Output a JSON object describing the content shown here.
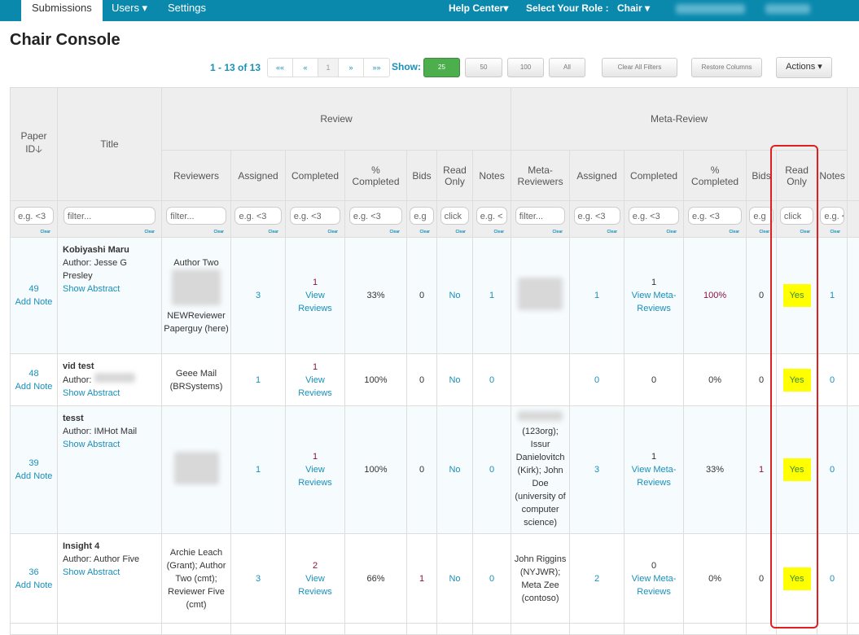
{
  "nav": {
    "tabs": [
      "Submissions",
      "Users ▾",
      "Settings"
    ],
    "help": "Help Center▾",
    "role_label": "Select Your Role :",
    "role": "Chair ▾"
  },
  "page_title": "Chair Console",
  "toolbar": {
    "count": "1 - 13 of 13",
    "pager": [
      "««",
      "«",
      "1",
      "»",
      "»»"
    ],
    "show_label": "Show:",
    "show_options": [
      "25",
      "50",
      "100",
      "All"
    ],
    "clear_filters": "Clear All Filters",
    "restore_columns": "Restore Columns",
    "actions": "Actions ▾"
  },
  "colors": {
    "nav": "#0a89ad",
    "link": "#1a8fb8",
    "highlight": "#ffff00",
    "outline": "#e02020"
  },
  "table": {
    "groups": {
      "paper_id": "Paper ID🡣",
      "title": "Title",
      "review": "Review",
      "meta_review": "Meta-Review"
    },
    "columns": [
      "Reviewers",
      "Assigned",
      "Completed",
      "% Completed",
      "Bids",
      "Read Only",
      "Notes",
      "Meta-Reviewers",
      "Assigned",
      "Completed",
      "% Completed",
      "Bids",
      "Read Only",
      "Notes"
    ],
    "filters": [
      "e.g. <3",
      "filter...",
      "filter...",
      "e.g. <3",
      "e.g. <3",
      "e.g. <3",
      "e.g",
      "click",
      "e.g. <",
      "filter...",
      "e.g. <3",
      "e.g. <3",
      "e.g. <3",
      "e.g",
      "click",
      "e.g. <"
    ],
    "clear": "Clear",
    "add_note": "Add Note",
    "show_abstract": "Show Abstract",
    "rows": [
      {
        "id": "49",
        "title": "Kobiyashi Maru",
        "author": "Author: Jesse G Presley",
        "reviewers": [
          "Author Two",
          "NEWReviewer Paperguy (here)"
        ],
        "assigned": "3",
        "completed": "1",
        "view": "View Reviews",
        "pct": "33%",
        "bids": "0",
        "read_only": "No",
        "notes": "1",
        "meta_reviewers": "",
        "m_assigned": "1",
        "m_completed": "1",
        "m_view": "View Meta-Reviews",
        "m_pct": "100%",
        "m_bids": "0",
        "m_read_only": "Yes",
        "m_notes": "1"
      },
      {
        "id": "48",
        "title": "vid test",
        "author": "Author:",
        "reviewers": [
          "Geee Mail (BRSystems)"
        ],
        "assigned": "1",
        "completed": "1",
        "view": "View Reviews",
        "pct": "100%",
        "bids": "0",
        "read_only": "No",
        "notes": "0",
        "meta_reviewers": "",
        "m_assigned": "0",
        "m_completed": "0",
        "m_view": "",
        "m_pct": "0%",
        "m_bids": "0",
        "m_read_only": "Yes",
        "m_notes": "0"
      },
      {
        "id": "39",
        "title": "tesst",
        "author": "Author: IMHot Mail",
        "reviewers": [
          ""
        ],
        "assigned": "1",
        "completed": "1",
        "view": "View Reviews",
        "pct": "100%",
        "bids": "0",
        "read_only": "No",
        "notes": "0",
        "meta_reviewers": "(123org); Issur Danielovitch (Kirk); John Doe (university of computer science)",
        "m_assigned": "3",
        "m_completed": "1",
        "m_view": "View Meta-Reviews",
        "m_pct": "33%",
        "m_bids": "1",
        "m_read_only": "Yes",
        "m_notes": "0"
      },
      {
        "id": "36",
        "title": "Insight 4",
        "author": "Author: Author Five",
        "reviewers": [
          "Archie Leach (Grant); Author Two (cmt); Reviewer Five (cmt)"
        ],
        "assigned": "3",
        "completed": "2",
        "view": "View Reviews",
        "pct": "66%",
        "bids": "1",
        "read_only": "No",
        "notes": "0",
        "meta_reviewers": "John Riggins (NYJWR); Meta Zee (contoso)",
        "m_assigned": "2",
        "m_completed": "0",
        "m_view": "View Meta-Reviews",
        "m_pct": "0%",
        "m_bids": "0",
        "m_read_only": "Yes",
        "m_notes": "0"
      }
    ]
  }
}
